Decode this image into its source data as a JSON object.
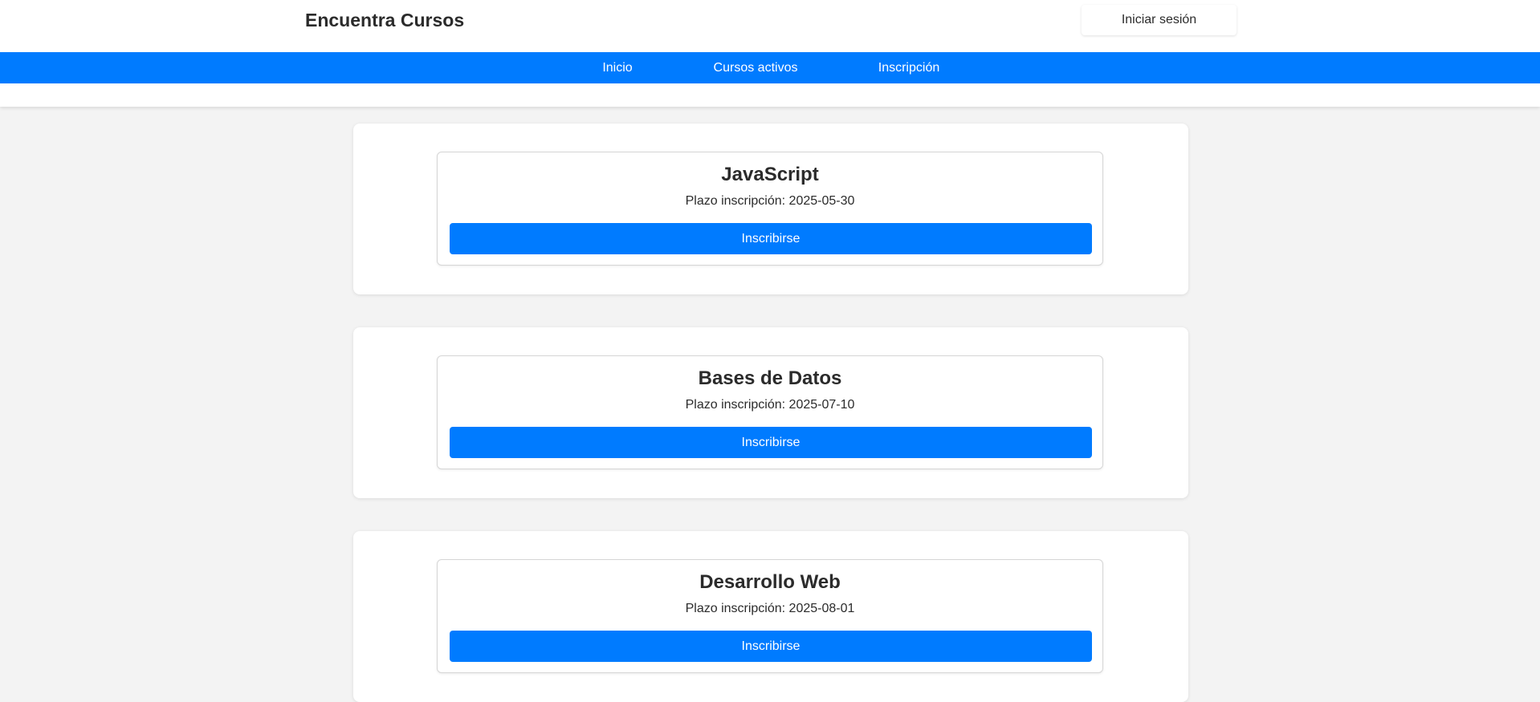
{
  "header": {
    "title": "Encuentra Cursos",
    "login_label": "Iniciar sesión"
  },
  "nav": {
    "items": [
      {
        "label": "Inicio"
      },
      {
        "label": "Cursos activos"
      },
      {
        "label": "Inscripción"
      }
    ]
  },
  "courses": [
    {
      "title": "JavaScript",
      "deadline": "Plazo inscripción: 2025-05-30",
      "button_label": "Inscribirse"
    },
    {
      "title": "Bases de Datos",
      "deadline": "Plazo inscripción: 2025-07-10",
      "button_label": "Inscribirse"
    },
    {
      "title": "Desarrollo Web",
      "deadline": "Plazo inscripción: 2025-08-01",
      "button_label": "Inscribirse"
    }
  ],
  "colors": {
    "accent": "#007bff",
    "background": "#f3f3f3",
    "text": "#2b2b2b"
  }
}
